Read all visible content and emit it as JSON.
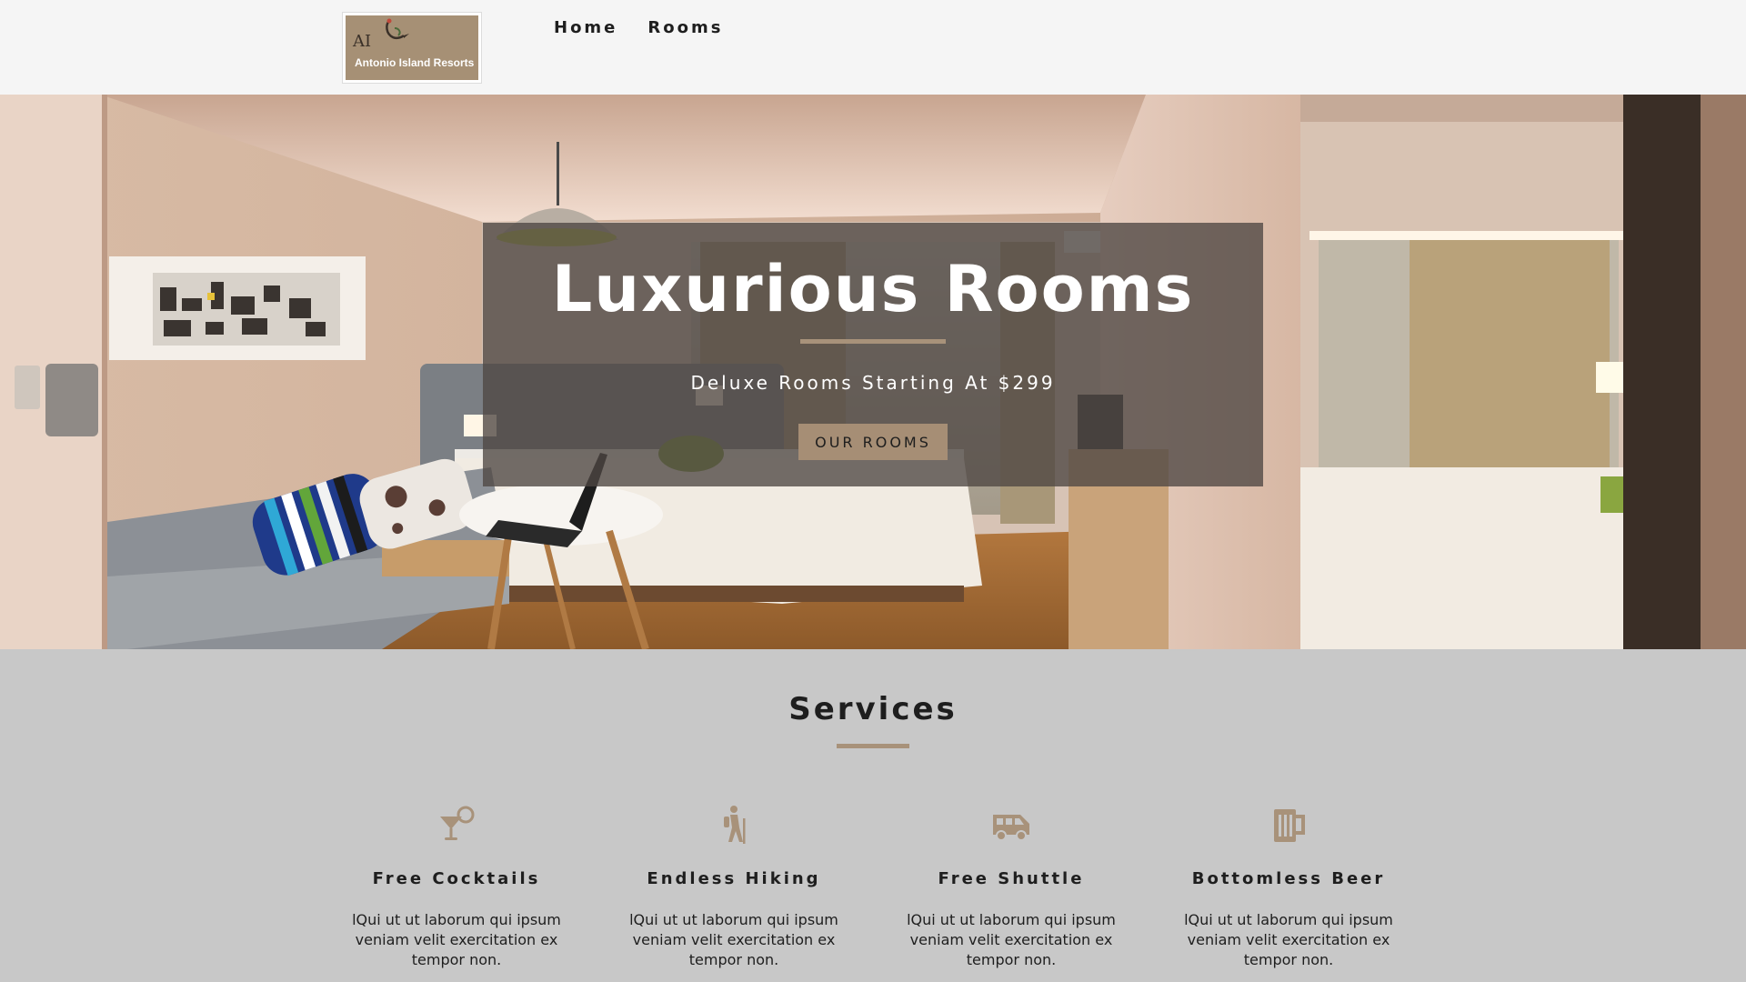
{
  "header": {
    "logo": {
      "mark": "AI",
      "name": "Antonio Island Resorts"
    },
    "nav": [
      {
        "label": "Home"
      },
      {
        "label": "Rooms"
      }
    ]
  },
  "hero": {
    "title": "Luxurious Rooms",
    "subtitle": "Deluxe Rooms Starting At $299",
    "button_label": "OUR ROOMS"
  },
  "services": {
    "title": "Services",
    "items": [
      {
        "icon": "cocktail-icon",
        "title": "Free Cocktails",
        "text": "lQui ut ut laborum qui ipsum veniam velit exercitation ex tempor non."
      },
      {
        "icon": "hiking-icon",
        "title": "Endless Hiking",
        "text": "lQui ut ut laborum qui ipsum veniam velit exercitation ex tempor non."
      },
      {
        "icon": "shuttle-icon",
        "title": "Free Shuttle",
        "text": "lQui ut ut laborum qui ipsum veniam velit exercitation ex tempor non."
      },
      {
        "icon": "beer-icon",
        "title": "Bottomless Beer",
        "text": "lQui ut ut laborum qui ipsum veniam velit exercitation ex tempor non."
      }
    ]
  },
  "colors": {
    "accent": "#a8927a",
    "header_bg": "#f5f5f5",
    "section_bg": "#c8c8c8",
    "text": "#1e1e1e"
  }
}
